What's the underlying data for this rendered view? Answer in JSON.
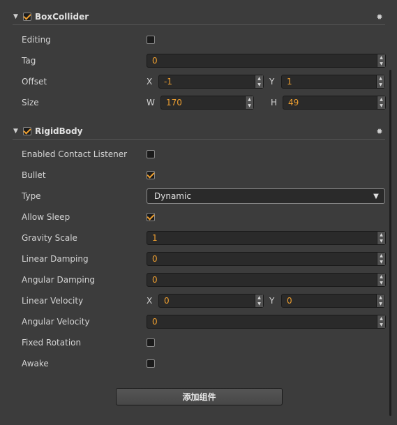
{
  "box_collider": {
    "title": "BoxCollider",
    "enabled": true,
    "editing_label": "Editing",
    "editing_checked": false,
    "tag_label": "Tag",
    "tag_value": "0",
    "offset_label": "Offset",
    "offset_x_axis": "X",
    "offset_x": "-1",
    "offset_y_axis": "Y",
    "offset_y": "1",
    "size_label": "Size",
    "size_w_axis": "W",
    "size_w": "170",
    "size_h_axis": "H",
    "size_h": "49"
  },
  "rigid_body": {
    "title": "RigidBody",
    "enabled": true,
    "contact_listener_label": "Enabled Contact Listener",
    "contact_listener_checked": false,
    "bullet_label": "Bullet",
    "bullet_checked": true,
    "type_label": "Type",
    "type_value": "Dynamic",
    "allow_sleep_label": "Allow Sleep",
    "allow_sleep_checked": true,
    "gravity_scale_label": "Gravity Scale",
    "gravity_scale": "1",
    "linear_damping_label": "Linear Damping",
    "linear_damping": "0",
    "angular_damping_label": "Angular Damping",
    "angular_damping": "0",
    "linear_velocity_label": "Linear Velocity",
    "linear_velocity_x_axis": "X",
    "linear_velocity_x": "0",
    "linear_velocity_y_axis": "Y",
    "linear_velocity_y": "0",
    "angular_velocity_label": "Angular Velocity",
    "angular_velocity": "0",
    "fixed_rotation_label": "Fixed Rotation",
    "fixed_rotation_checked": false,
    "awake_label": "Awake",
    "awake_checked": false
  },
  "add_component_label": "添加组件",
  "icons": {
    "collapse": "triangle-down-icon",
    "settings": "gear-icon",
    "spinner_up": "spinner-up-icon",
    "spinner_down": "spinner-down-icon",
    "dropdown": "dropdown-caret-icon"
  },
  "colors": {
    "panel_bg": "#3c3c3c",
    "field_bg": "#2a2a2a",
    "value_accent": "#f0a030",
    "checkmark": "#f0a030"
  }
}
